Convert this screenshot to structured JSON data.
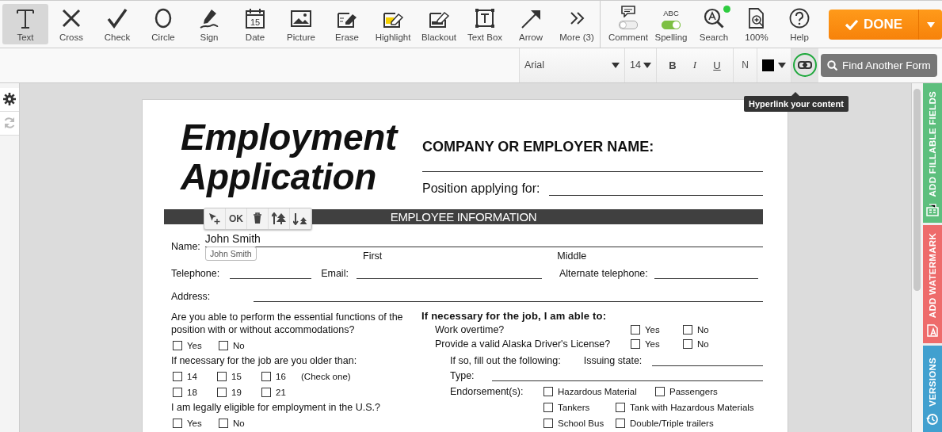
{
  "toolbar": {
    "tools": [
      {
        "label": "Text",
        "selected": true
      },
      {
        "label": "Cross",
        "selected": false
      },
      {
        "label": "Check",
        "selected": false
      },
      {
        "label": "Circle",
        "selected": false
      },
      {
        "label": "Sign",
        "selected": false
      },
      {
        "label": "Date",
        "selected": false,
        "icon_text": "15"
      },
      {
        "label": "Picture",
        "selected": false
      },
      {
        "label": "Erase",
        "selected": false
      },
      {
        "label": "Highlight",
        "selected": false
      },
      {
        "label": "Blackout",
        "selected": false
      },
      {
        "label": "Text Box",
        "selected": false
      },
      {
        "label": "Arrow",
        "selected": false
      },
      {
        "label": "More (3)",
        "selected": false
      }
    ],
    "review_tools": [
      {
        "label": "Comment",
        "kind": "toggle",
        "on": false
      },
      {
        "label": "Spelling",
        "kind": "toggle",
        "caption": "ABC",
        "on": true
      },
      {
        "label": "Search",
        "kind": "search",
        "notification": true
      },
      {
        "label": "100%",
        "kind": "zoom"
      },
      {
        "label": "Help",
        "kind": "help"
      }
    ],
    "done_button": "DONE"
  },
  "format_bar": {
    "font": "Arial",
    "size": "14",
    "styles": [
      "B",
      "I",
      "U"
    ],
    "normal": "N",
    "link_button": {
      "highlighted": true,
      "tooltip": "Hyperlink your content"
    },
    "find_button": "Find Another Form"
  },
  "document": {
    "title_lines": [
      "Employment",
      "Application"
    ],
    "company_label": "COMPANY OR EMPLOYER NAME:",
    "position_label": "Position applying for:",
    "section": "EMPLOYEE INFORMATION",
    "edit_toolbar": {
      "ok": "OK"
    },
    "name": {
      "label": "Name:",
      "value": "John Smith",
      "hint": "John Smith"
    },
    "name_parts": [
      "First",
      "Middle"
    ],
    "contact": [
      "Telephone:",
      "Email:",
      "Alternate telephone:"
    ],
    "address_label": "Address:",
    "left": [
      {
        "kind": "text",
        "text": "Are you able to perform the essential functions of the position with or without accommodations?"
      },
      {
        "kind": "options",
        "options": [
          {
            "label": "Yes",
            "checked": false
          },
          {
            "label": "No",
            "checked": false
          }
        ]
      },
      {
        "kind": "text",
        "text": "If necessary for the job are you older than:"
      },
      {
        "kind": "options",
        "options": [
          {
            "label": "14",
            "checked": false
          },
          {
            "label": "15",
            "checked": false
          },
          {
            "label": "16",
            "checked": false
          }
        ],
        "note": "(Check one)"
      },
      {
        "kind": "options",
        "options": [
          {
            "label": "18",
            "checked": false
          },
          {
            "label": "19",
            "checked": false
          },
          {
            "label": "21",
            "checked": false
          }
        ]
      },
      {
        "kind": "text",
        "text": "I am legally eligible for employment in the U.S.?"
      },
      {
        "kind": "options",
        "options": [
          {
            "label": "Yes",
            "checked": false
          },
          {
            "label": "No",
            "checked": false
          }
        ]
      }
    ],
    "right_heading": "If necessary for the job, I am able to:",
    "right": [
      {
        "kind": "question",
        "text": "Work overtime?",
        "options": [
          {
            "label": "Yes",
            "checked": false
          },
          {
            "label": "No",
            "checked": false
          }
        ]
      },
      {
        "kind": "question",
        "text": "Provide a valid Alaska Driver's License?",
        "options": [
          {
            "label": "Yes",
            "checked": false
          },
          {
            "label": "No",
            "checked": false
          }
        ]
      },
      {
        "kind": "field",
        "text": "If so, fill out the following:",
        "field_label": "Issuing state:"
      },
      {
        "kind": "field",
        "text": "Type:"
      },
      {
        "kind": "grid",
        "text": "Endorsement(s):",
        "rows": [
          [
            {
              "label": "Hazardous Material",
              "checked": false
            },
            {
              "label": "Passengers",
              "checked": false
            }
          ],
          [
            {
              "label": "Tankers",
              "checked": false
            },
            {
              "label": "Tank with Hazardous Materials",
              "checked": false
            }
          ],
          [
            {
              "label": "School Bus",
              "checked": false
            },
            {
              "label": "Double/Triple trailers",
              "checked": false
            }
          ]
        ]
      }
    ]
  },
  "side_tabs": [
    {
      "label": "ADD FILLABLE FIELDS",
      "color": "#5dbf7d"
    },
    {
      "label": "ADD WATERMARK",
      "color": "#ee6b6b"
    },
    {
      "label": "VERSIONS",
      "color": "#41a0cf"
    }
  ]
}
